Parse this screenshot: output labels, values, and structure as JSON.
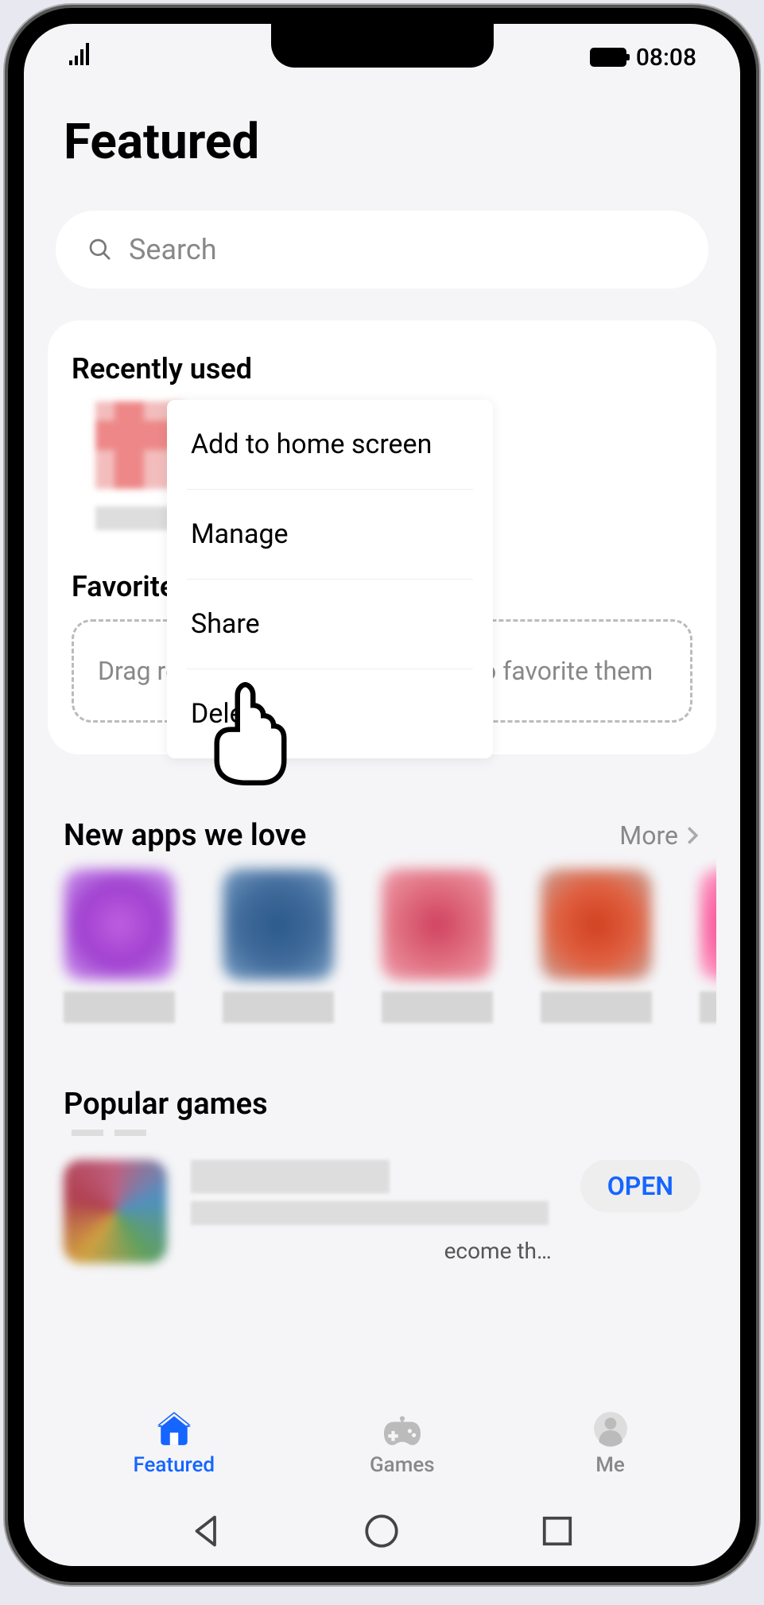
{
  "status": {
    "time": "08:08"
  },
  "page_title": "Featured",
  "search": {
    "placeholder": "Search"
  },
  "sections": {
    "recent": {
      "title": "Recently used"
    },
    "favorites": {
      "title": "Favorites",
      "drop_hint_full": "Drag recently used apps here to favorite them",
      "drop_hint_left": "Drag re",
      "drop_hint_right": "o favorite them"
    },
    "new_apps": {
      "title": "New apps we love",
      "more": "More"
    },
    "popular": {
      "title": "Popular games",
      "open": "OPEN",
      "desc_tail": "ecome th…"
    }
  },
  "context_menu": {
    "items": [
      "Add to home screen",
      "Manage",
      "Share",
      "Delete"
    ]
  },
  "bottom_nav": {
    "featured": "Featured",
    "games": "Games",
    "me": "Me"
  }
}
